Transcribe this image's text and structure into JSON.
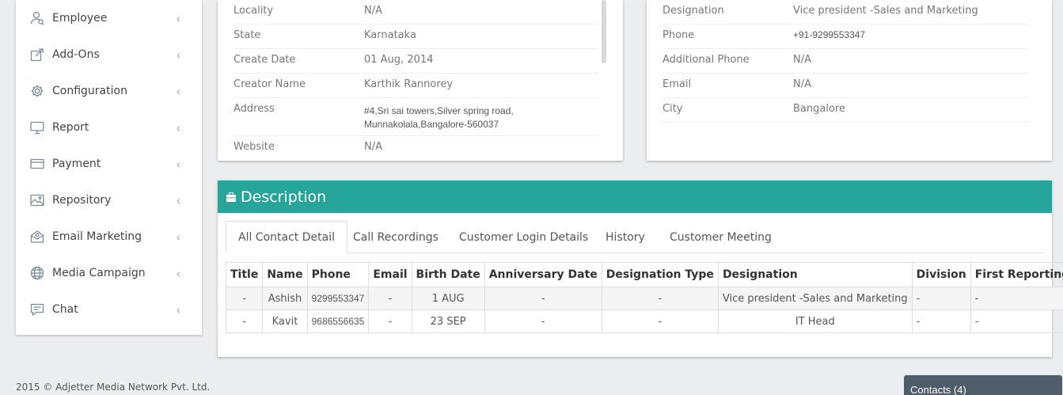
{
  "sidebar": {
    "items": [
      {
        "label": "Employee",
        "icon": "employee-icon"
      },
      {
        "label": "Add-Ons",
        "icon": "external-link-icon"
      },
      {
        "label": "Configuration",
        "icon": "gear-icon"
      },
      {
        "label": "Report",
        "icon": "monitor-icon"
      },
      {
        "label": "Payment",
        "icon": "credit-card-icon"
      },
      {
        "label": "Repository",
        "icon": "image-icon"
      },
      {
        "label": "Email Marketing",
        "icon": "envelope-open-icon"
      },
      {
        "label": "Media Campaign",
        "icon": "globe-icon"
      },
      {
        "label": "Chat",
        "icon": "chat-icon"
      }
    ],
    "chevron": "‹"
  },
  "company_info": {
    "rows": [
      {
        "key": "Locality",
        "value": "N/A"
      },
      {
        "key": "State",
        "value": "Karnataka"
      },
      {
        "key": "Create Date",
        "value": "01 Aug, 2014"
      },
      {
        "key": "Creator Name",
        "value": "Karthik Rannorey"
      },
      {
        "key": "Address",
        "value_line1": "#4,Sri sai towers,Silver spring road,",
        "value_line2": "Munnakolala,Bangalore-560037"
      },
      {
        "key": "Website",
        "value": "N/A"
      }
    ]
  },
  "contact_info": {
    "rows": [
      {
        "key": "Designation",
        "value": "Vice president -Sales and Marketing"
      },
      {
        "key": "Phone",
        "value": "+91-9299553347"
      },
      {
        "key": "Additional Phone",
        "value": "N/A"
      },
      {
        "key": "Email",
        "value": "N/A"
      },
      {
        "key": "City",
        "value": "Bangalore"
      }
    ]
  },
  "description": {
    "title": "Description",
    "tabs": [
      "All Contact Detail",
      "Call Recordings",
      "Customer Login Details",
      "History",
      "Customer Meeting"
    ],
    "active_tab": "All Contact Detail",
    "table": {
      "headers": [
        "Title",
        "Name",
        "Phone",
        "Email",
        "Birth Date",
        "Anniversary Date",
        "Designation Type",
        "Designation",
        "Division",
        "First Reporting"
      ],
      "rows": [
        [
          "-",
          "Ashish",
          "9299553347",
          "-",
          "1 AUG",
          "-",
          "-",
          "Vice president -Sales and Marketing",
          "-",
          "-"
        ],
        [
          "-",
          "Kavit",
          "9686556635",
          "-",
          "23 SEP",
          "-",
          "-",
          "IT Head",
          "-",
          "-"
        ]
      ]
    }
  },
  "footer": {
    "text": "2015 © Adjetter Media Network Pvt. Ltd."
  },
  "contacts_bar": {
    "label": "Contacts (4)"
  },
  "colors": {
    "accent": "#26a69a",
    "chat_bar": "#4f5d6a"
  }
}
